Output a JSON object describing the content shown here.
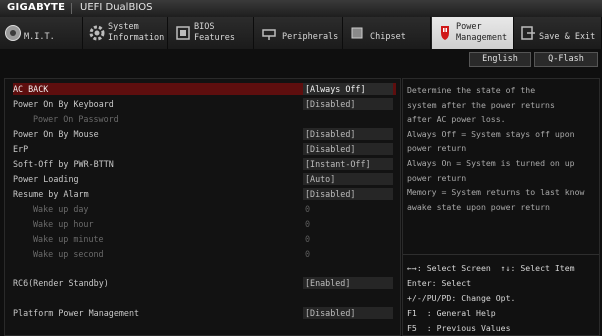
{
  "header": {
    "brand": "GIGABYTE",
    "product": "UEFI DualBIOS"
  },
  "tabs": [
    {
      "l1": "M.I.T.",
      "l2": ""
    },
    {
      "l1": "System",
      "l2": "Information"
    },
    {
      "l1": "BIOS",
      "l2": "Features"
    },
    {
      "l1": "Peripherals",
      "l2": ""
    },
    {
      "l1": "Chipset",
      "l2": ""
    },
    {
      "l1": "Power",
      "l2": "Management"
    },
    {
      "l1": "Save & Exit",
      "l2": ""
    }
  ],
  "buttons": {
    "language": "English",
    "qflash": "Q-Flash"
  },
  "settings": [
    {
      "label": "AC BACK",
      "value": "[Always Off]"
    },
    {
      "label": "Power On By Keyboard",
      "value": "[Disabled]"
    },
    {
      "label": "Power On Password",
      "value": ""
    },
    {
      "label": "Power On By Mouse",
      "value": "[Disabled]"
    },
    {
      "label": "ErP",
      "value": "[Disabled]"
    },
    {
      "label": "Soft-Off by PWR-BTTN",
      "value": "[Instant-Off]"
    },
    {
      "label": "Power Loading",
      "value": "[Auto]"
    },
    {
      "label": "Resume by Alarm",
      "value": "[Disabled]"
    },
    {
      "label": "Wake up day",
      "value": "0"
    },
    {
      "label": "Wake up hour",
      "value": "0"
    },
    {
      "label": "Wake up minute",
      "value": "0"
    },
    {
      "label": "Wake up second",
      "value": "0"
    },
    {
      "label": "RC6(Render Standby)",
      "value": "[Enabled]"
    },
    {
      "label": "Platform Power Management",
      "value": "[Disabled]"
    }
  ],
  "help": {
    "lines": [
      "Determine the state of  the",
      "system after the power returns",
      "after AC power loss.",
      "Always Off = System stays off upon",
      "power return",
      "Always On = System is turned on up",
      "power return",
      "Memory = System returns to last know",
      "awake state upon power return"
    ],
    "keys": [
      "←→: Select Screen  ↑↓: Select Item",
      "Enter: Select",
      "+/-/PU/PD: Change Opt.",
      "F1  : General Help",
      "F5  : Previous Values"
    ]
  },
  "colors": {
    "accent": "#5e0e0e",
    "power_icon": "#d01818"
  }
}
